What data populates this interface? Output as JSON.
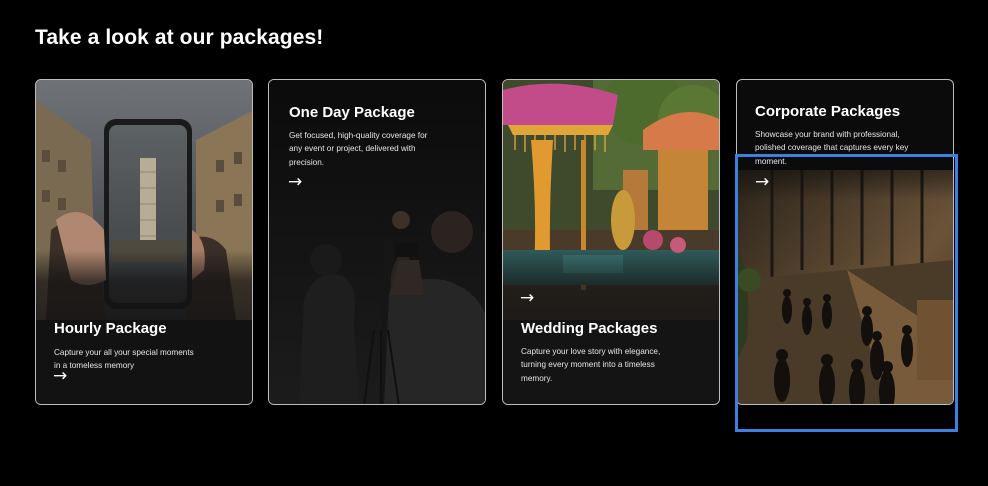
{
  "section": {
    "heading": "Take a look at our packages!"
  },
  "packages": [
    {
      "title": "Hourly Package",
      "description": "Capture your all your special moments in a tomeless memory",
      "arrow": "→"
    },
    {
      "title": "One Day Package",
      "description": "Get focused, high-quality coverage for any event or project, delivered with precision.",
      "arrow": "→"
    },
    {
      "title": "Wedding Packages",
      "description": "Capture your love story with elegance, turning every moment into a timeless memory.",
      "arrow": "→"
    },
    {
      "title": "Corporate Packages",
      "description": "Showcase your brand with professional, polished coverage that captures every key moment.",
      "arrow": "→"
    }
  ],
  "colors": {
    "background": "#000000",
    "card_border": "#bdbdbd",
    "highlight": "#3b82e0"
  }
}
